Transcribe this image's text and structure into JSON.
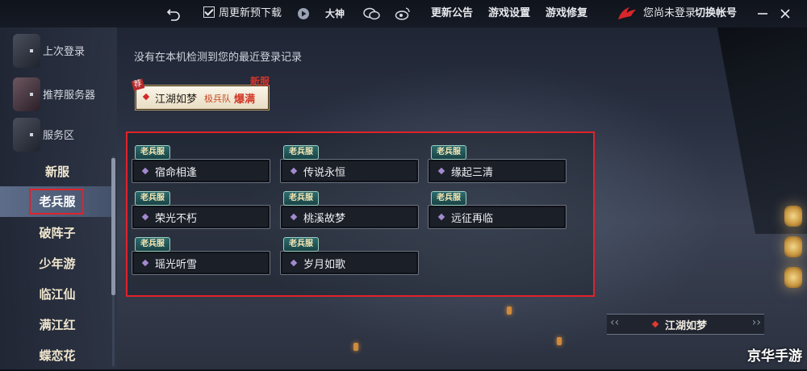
{
  "topbar": {
    "checkbox_label": "周更新预下载",
    "dashen_label": "大神",
    "links": [
      "更新公告",
      "游戏设置",
      "游戏修复"
    ],
    "login_status": "您尚未登录",
    "switch_account": "切换帐号"
  },
  "sidebar": {
    "top_items": [
      {
        "label": "上次登录"
      },
      {
        "label": "推荐服务器"
      },
      {
        "label": "服务区"
      }
    ],
    "categories": [
      "新服",
      "老兵服",
      "破阵子",
      "少年游",
      "临江仙",
      "满江红",
      "蝶恋花"
    ],
    "active_category": "老兵服"
  },
  "main": {
    "no_recent_text": "没有在本机检测到您的最近登录记录",
    "recent_server": {
      "name": "江湖如梦",
      "tag": "极兵队",
      "status": "爆满",
      "corner_tag": "荐",
      "new_label": "新服"
    },
    "server_badge": "老兵服",
    "servers": [
      "宿命相逢",
      "传说永恒",
      "缘起三清",
      "荣光不朽",
      "桃溪故梦",
      "远征再临",
      "瑶光听雪",
      "岁月如歌"
    ]
  },
  "current_server": {
    "name": "江湖如梦",
    "left_arrow": "‹‹",
    "right_arrow": "››"
  },
  "watermark": "京华手游",
  "colors": {
    "highlight_red": "#e0222a",
    "badge_teal": "#2c6b6d",
    "server_diamond": "#a28ad0"
  }
}
